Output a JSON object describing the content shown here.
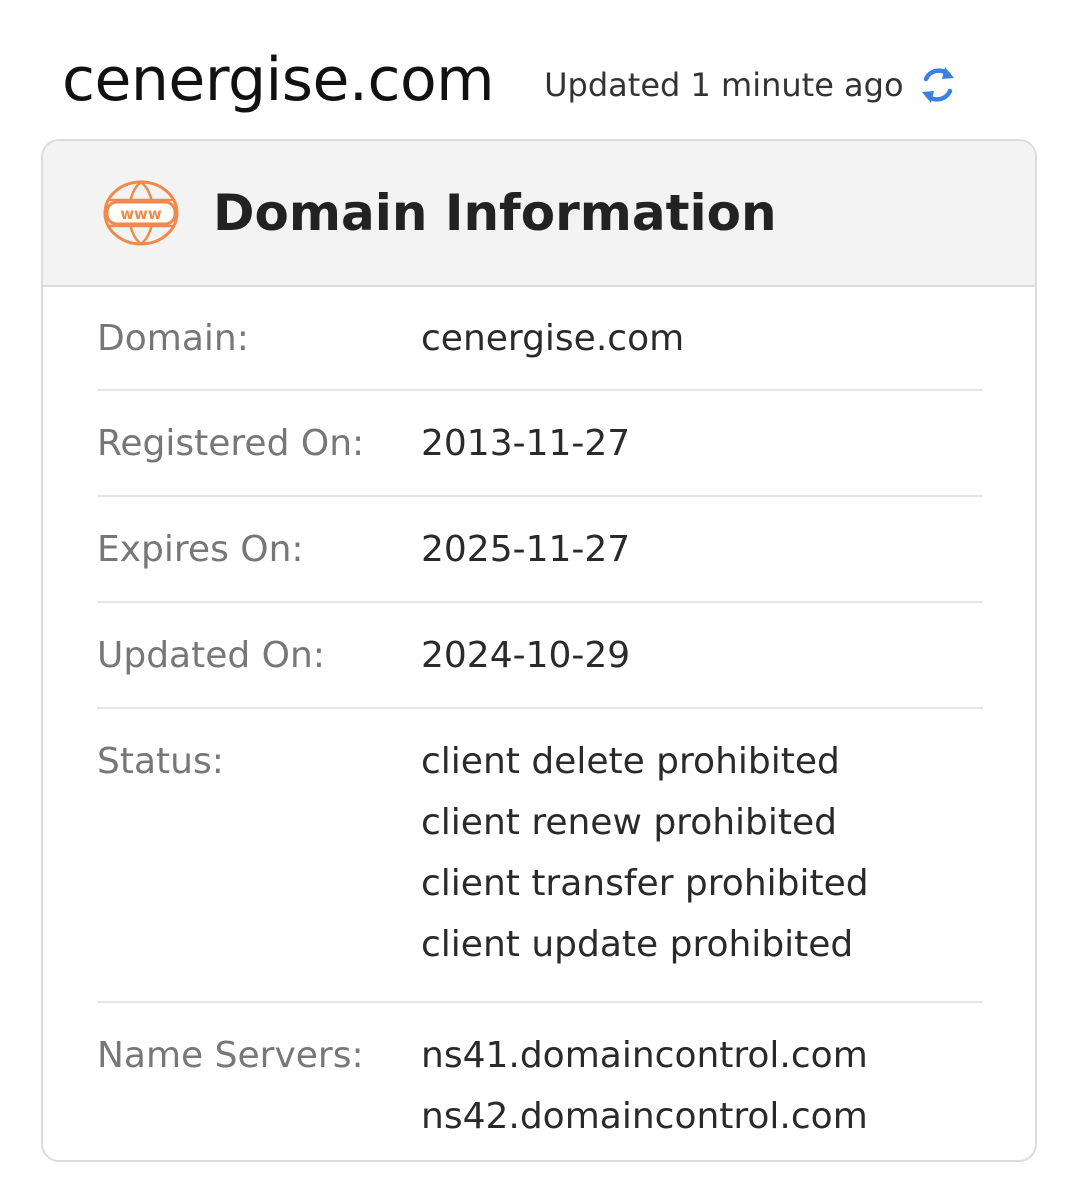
{
  "header": {
    "site_title": "cenergise.com",
    "updated_text": "Updated 1 minute ago",
    "refresh_icon": "refresh-icon"
  },
  "card": {
    "title": "Domain Information",
    "icon": "www-globe-icon",
    "icon_text": "www",
    "icon_color": "#f08a4b",
    "rows": [
      {
        "label": "Domain:",
        "values": [
          "cenergise.com"
        ]
      },
      {
        "label": "Registered On:",
        "values": [
          "2013-11-27"
        ]
      },
      {
        "label": "Expires On:",
        "values": [
          "2025-11-27"
        ]
      },
      {
        "label": "Updated On:",
        "values": [
          "2024-10-29"
        ]
      },
      {
        "label": "Status:",
        "values": [
          "client delete prohibited",
          "client renew prohibited",
          "client transfer prohibited",
          "client update prohibited"
        ]
      },
      {
        "label": "Name Servers:",
        "values": [
          "ns41.domaincontrol.com",
          "ns42.domaincontrol.com"
        ]
      }
    ]
  },
  "colors": {
    "accent_blue": "#3b82e0",
    "label_gray": "#777777",
    "header_bg": "#f3f3f3"
  }
}
